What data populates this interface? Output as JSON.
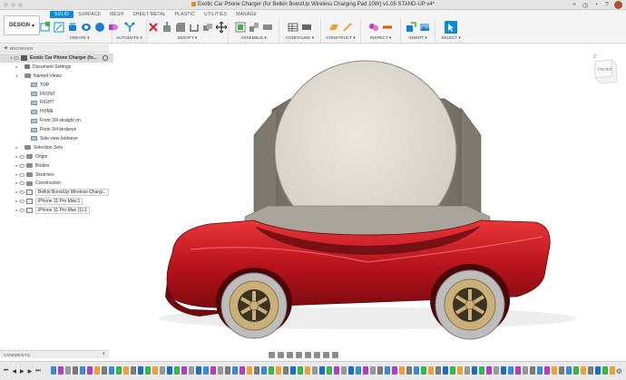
{
  "window": {
    "title": "Exotic Car Phone Charger (for Belkin BoostUp Wireless Charging Pad 10W) v1.05 STAND-UP v4*"
  },
  "workspace": {
    "label": "DESIGN",
    "caret": "▾"
  },
  "ribbon": {
    "tabs": [
      "SOLID",
      "SURFACE",
      "MESH",
      "SHEET METAL",
      "PLASTIC",
      "UTILITIES",
      "MANAGE"
    ],
    "active_tab": "SOLID",
    "groups": [
      {
        "label": "CREATE ▾"
      },
      {
        "label": "AUTOMATE ▾"
      },
      {
        "label": "MODIFY ▾"
      },
      {
        "label": "ASSEMBLE ▾"
      },
      {
        "label": "CONFIGURE ▾"
      },
      {
        "label": "CONSTRUCT ▾"
      },
      {
        "label": "INSPECT ▾"
      },
      {
        "label": "INSERT ▾"
      },
      {
        "label": "SELECT ▾"
      }
    ]
  },
  "browser": {
    "title": "BROWSER",
    "items": [
      {
        "label": "Exotic Car Phone Charger (fo...",
        "level": 0,
        "type": "root"
      },
      {
        "label": "Document Settings",
        "level": 1,
        "type": "settings"
      },
      {
        "label": "Named Views",
        "level": 1,
        "type": "folder"
      },
      {
        "label": "TOP",
        "level": 2,
        "type": "view"
      },
      {
        "label": "FRONT",
        "level": 2,
        "type": "view"
      },
      {
        "label": "RIGHT",
        "level": 2,
        "type": "view"
      },
      {
        "label": "HOME",
        "level": 2,
        "type": "view"
      },
      {
        "label": "Front 3/4 straight on",
        "level": 2,
        "type": "view"
      },
      {
        "label": "Front 3/4 birdseye",
        "level": 2,
        "type": "view"
      },
      {
        "label": "Side view birdseye",
        "level": 2,
        "type": "view"
      },
      {
        "label": "Selection Sets",
        "level": 1,
        "type": "folder"
      },
      {
        "label": "Origin",
        "level": 1,
        "type": "folder"
      },
      {
        "label": "Bodies",
        "level": 1,
        "type": "folder"
      },
      {
        "label": "Sketches",
        "level": 1,
        "type": "folder"
      },
      {
        "label": "Construction",
        "level": 1,
        "type": "folder"
      },
      {
        "label": "Belkin BoostUp Wireless Chargi...",
        "level": 1,
        "type": "component"
      },
      {
        "label": "iPhone 11 Pro Max:1",
        "level": 1,
        "type": "component"
      },
      {
        "label": "iPhone 11 Pro Max (1):1",
        "level": 1,
        "type": "component"
      }
    ]
  },
  "viewcube": {
    "face": "FRONT",
    "axis": "Z"
  },
  "comments": {
    "title": "COMMENTS",
    "add": "+"
  },
  "timeline": {
    "controls": [
      "⏮",
      "◀",
      "▶",
      "▶",
      "⏭"
    ]
  },
  "colors": {
    "accent": "#0f8ad9",
    "car_body": "#c8181c",
    "stand": "#8e8a7e",
    "pad": "#dedad0",
    "wheel_gold": "#c9b07a"
  }
}
